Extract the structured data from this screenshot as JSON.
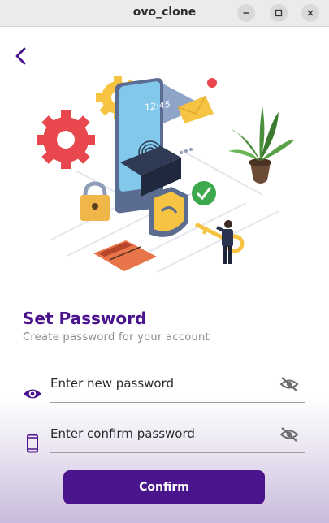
{
  "window": {
    "title": "ovo_clone",
    "minimize_icon": "minimize-icon",
    "maximize_icon": "maximize-icon",
    "close_icon": "close-icon"
  },
  "nav": {
    "back_icon": "chevron-left-icon"
  },
  "illustration": {
    "icon": "security-phone-illustration"
  },
  "header": {
    "title": "Set Password",
    "subtitle": "Create password for your account"
  },
  "form": {
    "new_password": {
      "placeholder": "Enter new password",
      "leading_icon": "eye-icon",
      "toggle_icon": "eye-off-icon"
    },
    "confirm_password": {
      "placeholder": "Enter confirm password",
      "leading_icon": "phone-icon",
      "toggle_icon": "eye-off-icon"
    },
    "confirm_label": "Confirm"
  },
  "colors": {
    "accent": "#4a148c",
    "titlebar": "#ebebeb"
  }
}
